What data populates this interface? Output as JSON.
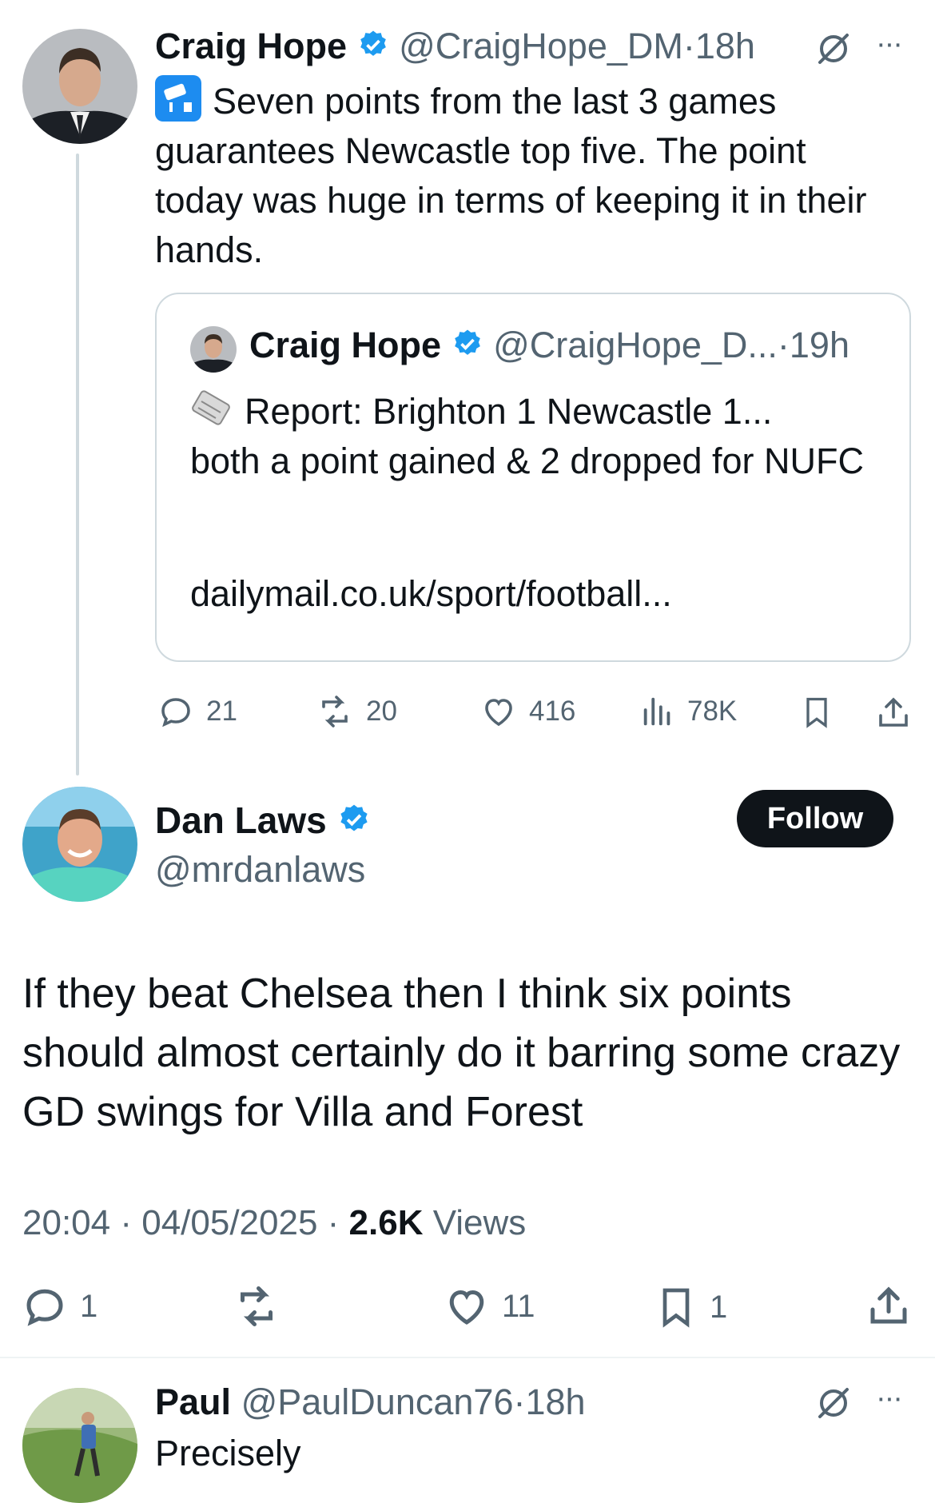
{
  "tweet1": {
    "name": "Craig Hope",
    "handle": "@CraigHope_DM",
    "dot": "·",
    "time": "18h",
    "more": "···",
    "text": "Seven points from the last 3 games guarantees Newcastle top five. The point today was huge in terms of keeping it in their hands.",
    "quote": {
      "name": "Craig Hope",
      "handle": "@CraigHope_D...",
      "dot": "·",
      "time": "19h",
      "text_line1": "Report: Brighton 1 Newcastle 1...",
      "text_rest": "both a point gained & 2 dropped for NUFC",
      "link": "dailymail.co.uk/sport/football..."
    },
    "actions": {
      "replies": "21",
      "reposts": "20",
      "likes": "416",
      "views": "78K"
    }
  },
  "tweet2": {
    "name": "Dan Laws",
    "handle": "@mrdanlaws",
    "follow_label": "Follow",
    "text": "If they beat Chelsea then I think six points should almost certainly do it barring some crazy GD swings for Villa and Forest",
    "time": "20:04",
    "sep": " · ",
    "date": "04/05/2025",
    "views_count": "2.6K",
    "views_label": " Views",
    "actions": {
      "replies": "1",
      "likes": "11",
      "bookmarks": "1"
    }
  },
  "tweet3": {
    "name": "Paul",
    "handle": "@PaulDuncan76",
    "dot": "·",
    "time": "18h",
    "more": "···",
    "text": "Precisely"
  },
  "colors": {
    "accent": "#1d9bf0",
    "text": "#0f1419",
    "muted": "#536471",
    "border": "#cfd9de"
  }
}
